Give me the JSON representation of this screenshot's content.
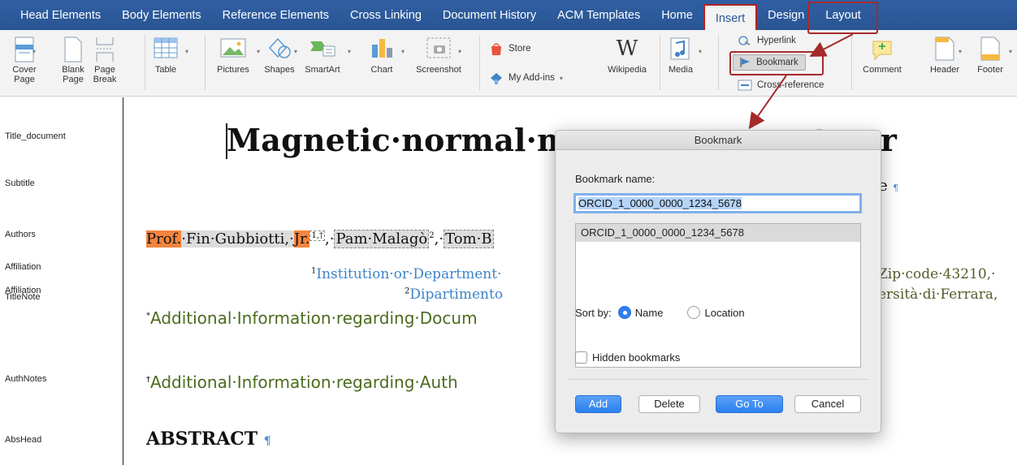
{
  "tabs": [
    "Head Elements",
    "Body Elements",
    "Reference Elements",
    "Cross Linking",
    "Document History",
    "ACM Templates",
    "Home",
    "Insert",
    "Design",
    "Layout"
  ],
  "active_tab": "Insert",
  "ribbon": {
    "cover_page": "Cover\nPage",
    "blank_page": "Blank\nPage",
    "page_break": "Page\nBreak",
    "table": "Table",
    "pictures": "Pictures",
    "shapes": "Shapes",
    "smartart": "SmartArt",
    "chart": "Chart",
    "screenshot": "Screenshot",
    "store": "Store",
    "my_addins": "My Add-ins",
    "wikipedia": "Wikipedia",
    "media": "Media",
    "hyperlink": "Hyperlink",
    "bookmark": "Bookmark",
    "cross_reference": "Cross-reference",
    "comment": "Comment",
    "header": "Header",
    "footer": "Footer"
  },
  "style_labels": [
    "Title_document",
    "Subtitle",
    "Authors",
    "Affiliation",
    "Affiliation",
    "TitleNote",
    "AuthNotes",
    "AbsHead"
  ],
  "document": {
    "title": "Magnetic·normal·m",
    "title_end": "nent·per",
    "subtitle_end": "e",
    "pilcrow": "¶",
    "authors_prof": "Prof.",
    "authors_name": "·Fin·Gubbiotti,·",
    "authors_jr": "Jr.",
    "authors_sup1": "1,†",
    "authors_mid": ",·",
    "authors_pam": "Pam·Malagò",
    "authors_sup2": "2",
    "authors_tom": "Tom·B",
    "aff1_sup": "1",
    "aff1": "Institution·or·Department·",
    "aff1_end": "Zip·code·43210,·",
    "aff2_sup": "2",
    "aff2": "Dipartimento",
    "aff2_end": "ersità·di·Ferrara,",
    "titlenote_sup": "*",
    "titlenote": "Additional·Information·regarding·Docum",
    "authnote_sup": "†",
    "authnote": "Additional·Information·regarding·Auth",
    "abstract": "ABSTRACT"
  },
  "dialog": {
    "title": "Bookmark",
    "name_label": "Bookmark name:",
    "name_value": "ORCID_1_0000_0000_1234_5678",
    "list_items": [
      "ORCID_1_0000_0000_1234_5678"
    ],
    "sort_label": "Sort by:",
    "sort_name": "Name",
    "sort_location": "Location",
    "hidden_label": "Hidden bookmarks",
    "btn_add": "Add",
    "btn_delete": "Delete",
    "btn_goto": "Go To",
    "btn_cancel": "Cancel"
  }
}
